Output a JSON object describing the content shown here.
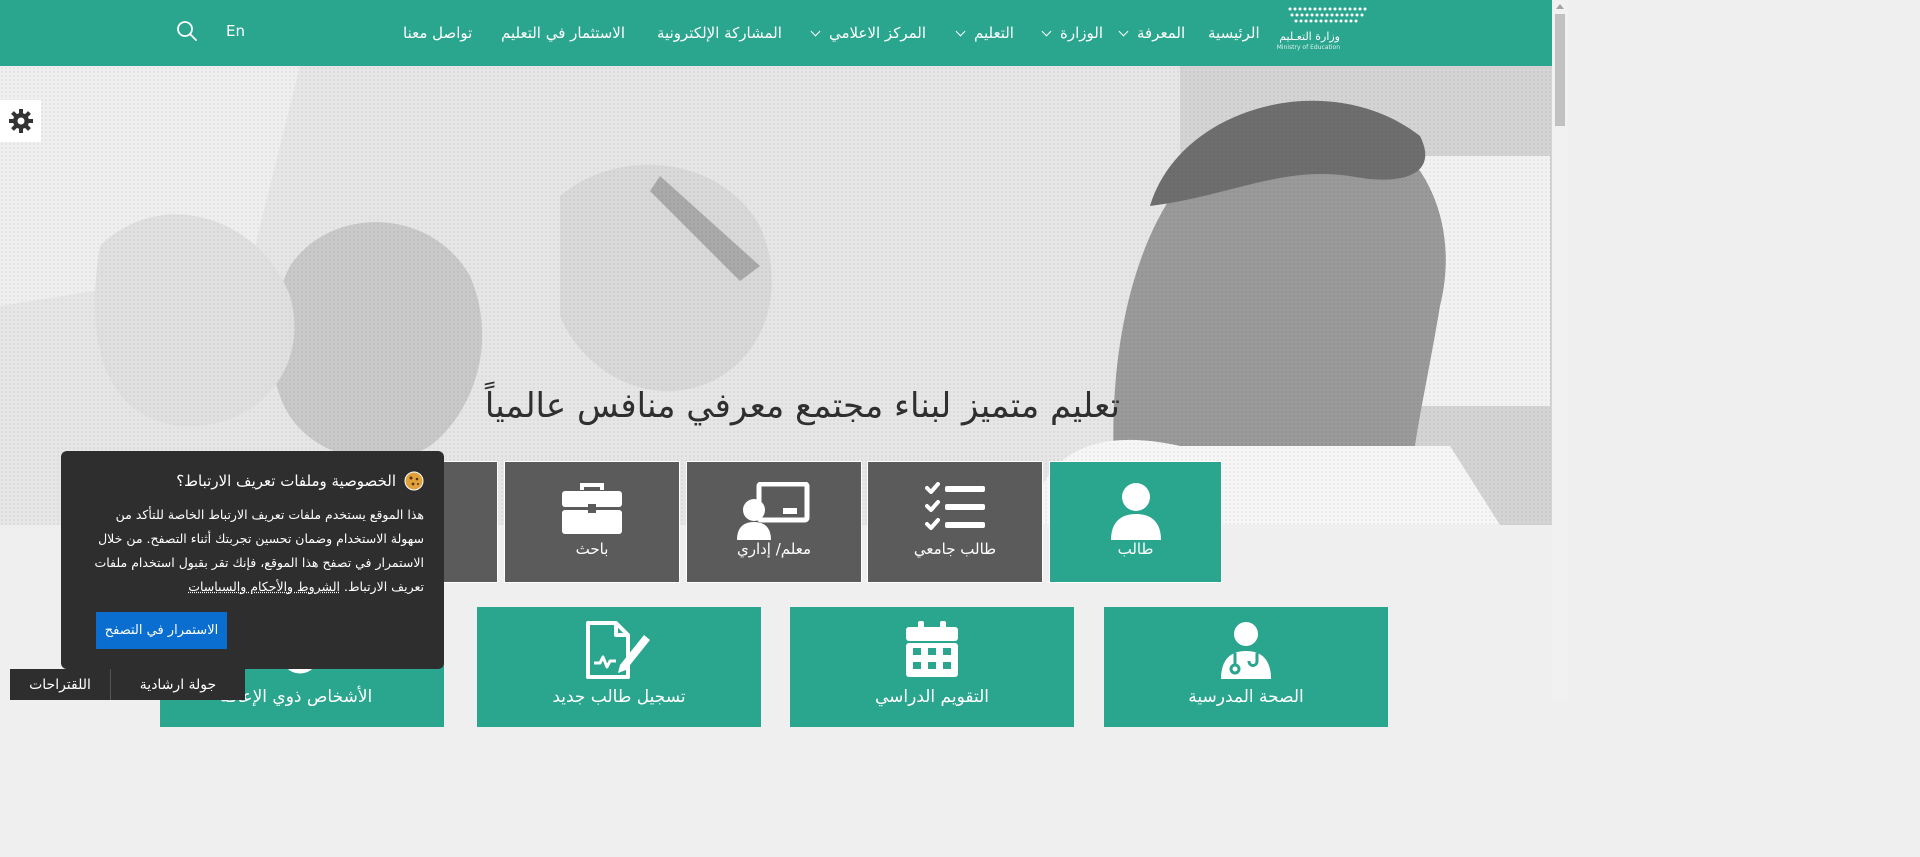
{
  "colors": {
    "primary": "#2aa58e",
    "card_dark": "#5b5b5b",
    "popup_bg": "#2e2e2e",
    "accept_button": "#0a6ed1"
  },
  "logo": {
    "arabic": "وزارة التعـليم",
    "english": "Ministry of Education"
  },
  "nav": {
    "home": "الرئيسية",
    "knowledge": "المعرفة",
    "ministry": "الوزارة",
    "education": "التعليم",
    "media_center": "المركز الاعلامي",
    "e_participation": "المشاركة الإلكترونية",
    "investment": "الاستثمار في التعليم",
    "contact": "تواصل معنا",
    "language": "En",
    "search_icon": "search-icon"
  },
  "hero": {
    "title": "تعليم متميز لبناء مجتمع معرفي منافس عالمياً"
  },
  "settings": {
    "icon": "gear-icon"
  },
  "roles": [
    {
      "label": "طالب",
      "icon": "user-icon",
      "active": true
    },
    {
      "label": "طالب جامعي",
      "icon": "checklist-icon",
      "active": false
    },
    {
      "label": "معلم/ إداري",
      "icon": "teacher-board-icon",
      "active": false
    },
    {
      "label": "باحث",
      "icon": "briefcase-icon",
      "active": false
    }
  ],
  "services": [
    {
      "label": "الصحة المدرسية",
      "icon": "doctor-icon"
    },
    {
      "label": "التقويم الدراسي",
      "icon": "calendar-icon"
    },
    {
      "label": "تسجيل طالب جديد",
      "icon": "document-pen-icon"
    },
    {
      "label": "الأشخاص ذوي الإعاقة",
      "icon": "accessibility-icon"
    }
  ],
  "cookie": {
    "icon": "cookie-icon",
    "title": "الخصوصية وملفات تعريف الارتباط؟",
    "body": "هذا الموقع يستخدم ملفات تعريف الارتباط الخاصة للتأكد من سهولة الاستخدام وضمان تحسين تجربتك أثناء التصفح. من خلال الاستمرار في تصفح هذا الموقع، فإنك تقر بقبول استخدام ملفات تعريف الارتباط.",
    "link": "الشروط والأحكام والسياسات",
    "accept": "الاستمرار في التصفح"
  },
  "bottom": {
    "tour": "جولة ارشادية",
    "suggestions": "اللقتراحات"
  }
}
